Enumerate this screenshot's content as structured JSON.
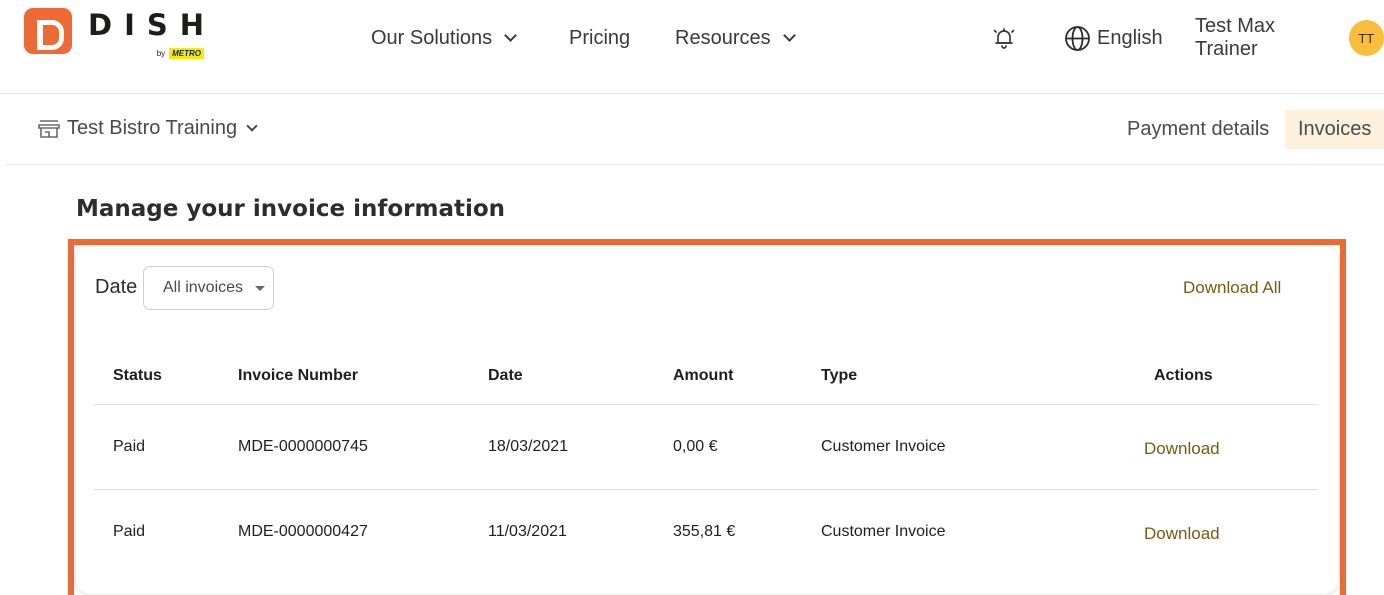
{
  "brand": {
    "name": "DISH",
    "by": "by",
    "partner": "METRO"
  },
  "nav": {
    "solutions": "Our Solutions",
    "pricing": "Pricing",
    "resources": "Resources",
    "language": "English",
    "user_name": "Test Max Trainer",
    "user_initials": "TT"
  },
  "subnav": {
    "venue": "Test Bistro Training",
    "tab_payment": "Payment details",
    "tab_invoices": "Invoices"
  },
  "main": {
    "title": "Manage your invoice information",
    "filter_label": "Date",
    "filter_value": "All invoices",
    "download_all": "Download All"
  },
  "table": {
    "headers": {
      "status": "Status",
      "number": "Invoice Number",
      "date": "Date",
      "amount": "Amount",
      "type": "Type",
      "actions": "Actions"
    },
    "rows": [
      {
        "status": "Paid",
        "number": "MDE-0000000745",
        "date": "18/03/2021",
        "amount": "0,00 €",
        "type": "Customer Invoice",
        "action": "Download"
      },
      {
        "status": "Paid",
        "number": "MDE-0000000427",
        "date": "11/03/2021",
        "amount": "355,81 €",
        "type": "Customer Invoice",
        "action": "Download"
      }
    ]
  },
  "colors": {
    "brand_orange": "#ee6a35",
    "avatar_yellow": "#fbbd3c",
    "link_brown": "#7a5a10",
    "active_tab_bg": "#fdf1de"
  }
}
